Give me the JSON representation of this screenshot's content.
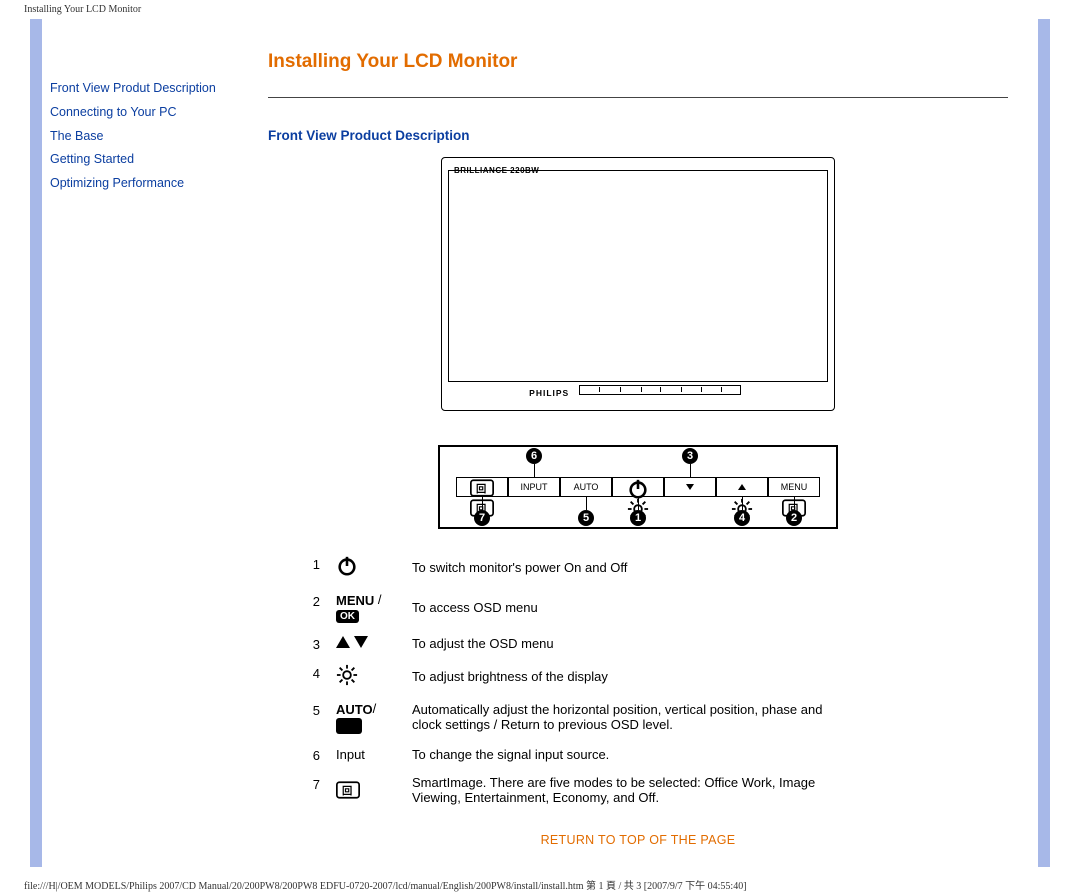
{
  "header_strip": "Installing Your LCD Monitor",
  "page_title": "Installing Your LCD Monitor",
  "sidebar": {
    "items": [
      "Front View Produt Description",
      "Connecting to Your PC",
      "The Base",
      "Getting Started",
      "Optimizing Performance"
    ]
  },
  "section_title": "Front View Product Description",
  "monitor_brand_top": "BRILLIANCE 220BW",
  "monitor_brand_bottom": "PHILIPS",
  "panel_buttons": [
    {
      "label_svg": "si",
      "below_svg": "si",
      "callout_bottom": "7"
    },
    {
      "label": "INPUT",
      "callout_top": "6"
    },
    {
      "label": "AUTO",
      "callout_bottom": "5"
    },
    {
      "label_svg": "power",
      "below_svg": "brightness",
      "callout_bottom": "1"
    },
    {
      "label_svg": "tri-down",
      "callout_top": "3"
    },
    {
      "label_svg": "tri-up",
      "below_svg": "brightness",
      "callout_bottom": "4"
    },
    {
      "label": "MENU",
      "below_svg": "si",
      "callout_bottom": "2"
    }
  ],
  "desc_table": [
    {
      "n": "1",
      "icon": "power",
      "text": "To switch monitor's power On and Off"
    },
    {
      "n": "2",
      "icon": "menu-ok",
      "text": "To access OSD menu"
    },
    {
      "n": "3",
      "icon": "arrows",
      "text": "To adjust the OSD menu"
    },
    {
      "n": "4",
      "icon": "brightness",
      "text": "To adjust brightness of the display"
    },
    {
      "n": "5",
      "icon": "auto-ret",
      "text": "Automatically adjust the horizontal position, vertical position, phase and clock settings / Return to previous OSD level."
    },
    {
      "n": "6",
      "icon": "input",
      "text": "To change the signal input source."
    },
    {
      "n": "7",
      "icon": "smartimage",
      "text": "SmartImage. There are five modes to be selected: Office Work, Image Viewing, Entertainment, Economy, and Off."
    }
  ],
  "input_label": "Input",
  "menu_label": "MENU",
  "ok_label": "OK",
  "auto_label": "AUTO",
  "return_link": "RETURN TO TOP OF THE PAGE",
  "footer_path": "file:///H|/OEM MODELS/Philips 2007/CD Manual/20/200PW8/200PW8 EDFU-0720-2007/lcd/manual/English/200PW8/install/install.htm 第 1 頁 / 共 3  [2007/9/7 下午 04:55:40]"
}
